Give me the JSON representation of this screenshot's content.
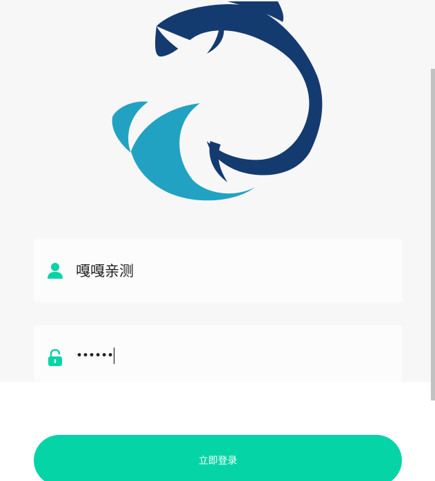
{
  "login_form": {
    "username_value": "嘎嘎亲测",
    "password_masked": "••••••",
    "submit_label": "立即登录"
  },
  "colors": {
    "background": "#f7f7f8",
    "field_background": "#fcfcfc",
    "accent": "#05d4a6",
    "logo_dark": "#143b70",
    "logo_light": "#22a2c2"
  },
  "icons": {
    "username": "user-icon",
    "password": "lock-icon"
  }
}
